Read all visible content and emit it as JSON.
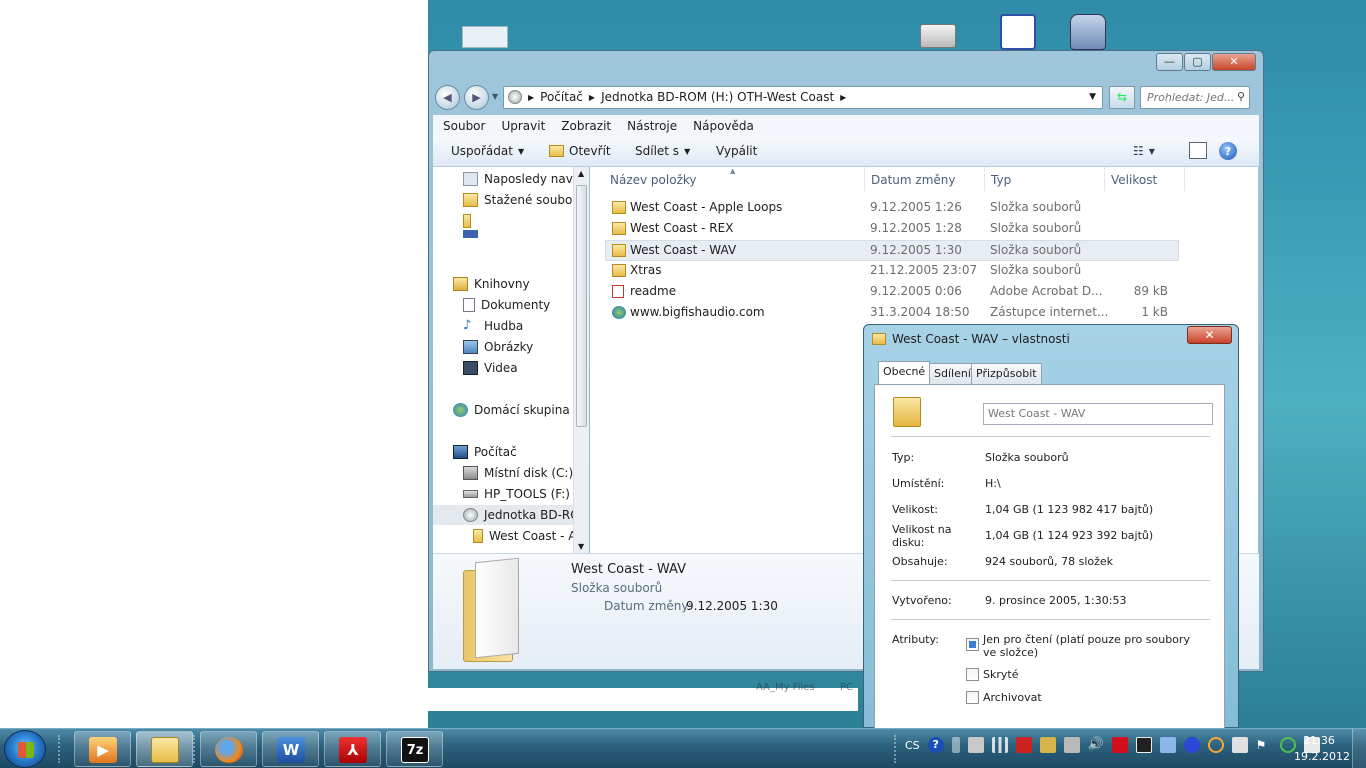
{
  "desktop": {
    "icons": [
      {
        "icon": "drive-icon",
        "label": ""
      },
      {
        "icon": "network-shortcut-icon",
        "label": ""
      },
      {
        "icon": "projector-shortcut-icon",
        "label": ""
      }
    ],
    "faded_labels": [
      "AA_My Files",
      "PC"
    ]
  },
  "explorer": {
    "address": {
      "crumbs": [
        "Počítač",
        "Jednotka BD-ROM (H:) OTH-West Coast"
      ]
    },
    "search": {
      "placeholder": "Prohledat: Jed..."
    },
    "menu": [
      "Soubor",
      "Upravit",
      "Zobrazit",
      "Nástroje",
      "Nápověda"
    ],
    "commands": {
      "organize": "Uspořádat",
      "open": "Otevřít",
      "share": "Sdílet s",
      "burn": "Vypálit"
    },
    "nav": {
      "recent": "Naposledy navští",
      "downloads": "Stažené soubory",
      "libraries": "Knihovny",
      "documents": "Dokumenty",
      "music": "Hudba",
      "pictures": "Obrázky",
      "videos": "Videa",
      "homegroup": "Domácí skupina",
      "computer": "Počítač",
      "local_disk": "Místní disk (C:)",
      "hp_tools": "HP_TOOLS (F:)",
      "bd_rom": "Jednotka BD-ROM",
      "sub_a": "West Coast - A"
    },
    "columns": {
      "name": "Název položky",
      "date": "Datum změny",
      "type": "Typ",
      "size": "Velikost"
    },
    "files": [
      {
        "name": "West Coast - Apple Loops",
        "date": "9.12.2005 1:26",
        "type": "Složka souborů",
        "size": "",
        "icon": "folder-icon"
      },
      {
        "name": "West Coast - REX",
        "date": "9.12.2005 1:28",
        "type": "Složka souborů",
        "size": "",
        "icon": "folder-icon"
      },
      {
        "name": "West Coast - WAV",
        "date": "9.12.2005 1:30",
        "type": "Složka souborů",
        "size": "",
        "icon": "folder-icon"
      },
      {
        "name": "Xtras",
        "date": "21.12.2005 23:07",
        "type": "Složka souborů",
        "size": "",
        "icon": "folder-icon"
      },
      {
        "name": "readme",
        "date": "9.12.2005 0:06",
        "type": "Adobe Acrobat D...",
        "size": "89 kB",
        "icon": "pdf-icon"
      },
      {
        "name": "www.bigfishaudio.com",
        "date": "31.3.2004 18:50",
        "type": "Zástupce internet...",
        "size": "1 kB",
        "icon": "internet-shortcut-icon"
      }
    ],
    "details": {
      "title": "West Coast - WAV",
      "type": "Složka souborů",
      "date_label": "Datum změny:",
      "date_value": "9.12.2005 1:30"
    }
  },
  "properties": {
    "title": "West Coast - WAV – vlastnosti",
    "close": "✕",
    "tabs": [
      "Obecné",
      "Sdílení",
      "Přizpůsobit"
    ],
    "name_value": "West Coast - WAV",
    "rows": {
      "type_label": "Typ:",
      "type_value": "Složka souborů",
      "location_label": "Umístění:",
      "location_value": "H:\\",
      "size_label": "Velikost:",
      "size_value": "1,04 GB (1 123 982 417 bajtů)",
      "disk_label": "Velikost na disku:",
      "disk_value": "1,04 GB (1 124 923 392 bajtů)",
      "contains_label": "Obsahuje:",
      "contains_value": "924 souborů, 78 složek",
      "created_label": "Vytvořeno:",
      "created_value": "9. prosince 2005, 1:30:53",
      "attributes_label": "Atributy:"
    },
    "attributes": [
      {
        "label": "Jen pro čtení (platí pouze pro soubory ve složce)",
        "checked": true
      },
      {
        "label": "Skryté",
        "checked": false
      },
      {
        "label": "Archivovat",
        "checked": false
      }
    ]
  },
  "taskbar": {
    "apps": [
      "media-player-icon",
      "explorer-icon",
      "firefox-icon",
      "word-icon",
      "acrobat-icon",
      "7zip-icon"
    ],
    "word_glyph": "W",
    "sevenzip_glyph": "7z",
    "lang": "CS",
    "clock": {
      "time": "21:36",
      "date": "19.2.2012"
    }
  }
}
